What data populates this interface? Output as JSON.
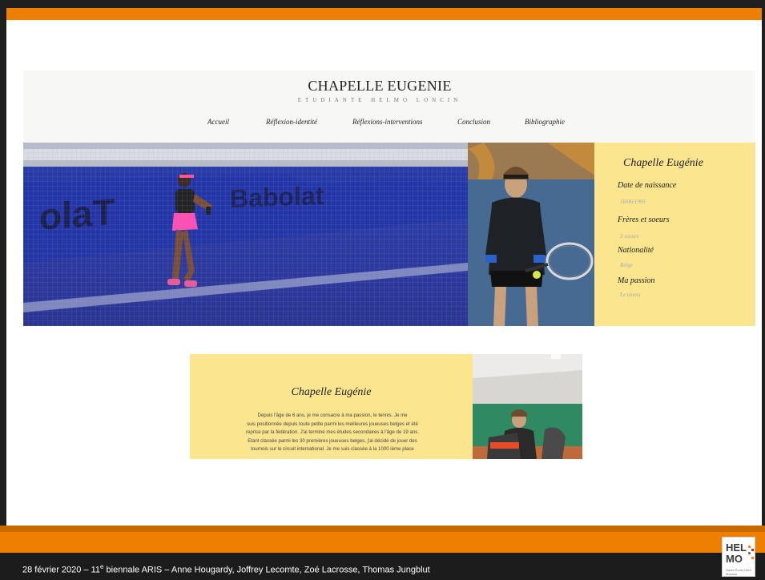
{
  "footer": {
    "text_before": "28 février 2020 – 11",
    "superscript": "e",
    "text_after": " biennale  ARIS – Anne Hougardy, Joffrey Lecomte, Zoé Lacrosse, Thomas Jungblut"
  },
  "logo": {
    "line1": "HEL",
    "line2": "MO",
    "subtitle": "Haute École Libre Mosane"
  },
  "site": {
    "title": "CHAPELLE EUGENIE",
    "subtitle": "ETUDIANTE HELMO LONCIN",
    "nav": [
      "Accueil",
      "Réflexion-identité",
      "Réflexions-interventions",
      "Conclusion",
      "Bibliographie"
    ],
    "hero_banner_text": "Babolat",
    "info": {
      "name": "Chapelle Eugénie",
      "birth_label": "Date de naissance",
      "birth_value": "16/06/1995",
      "siblings_label": "Frères et soeurs",
      "siblings_value": "3 soeurs",
      "nationality_label": "Nationalité",
      "nationality_value": "Belge",
      "passion_label": "Ma passion",
      "passion_value": "Le tennis"
    },
    "bio": {
      "name": "Chapelle Eugénie",
      "lines": [
        "Depuis l'âge de 6 ans, je me consacre à ma passion, le tennis. Je me",
        "suis positionnée depuis toute petite parmi les meilleures joueuses belges et été",
        "reprise par la fédération. J'ai terminé mes études secondaires à l'âge de 19 ans.",
        "Etant classée parmi les 30 premières joueuses belges, j'ai décidé de jouer des",
        "tournois sur le circuit international. Je me suis classée à la 1000 ième place"
      ]
    }
  },
  "colors": {
    "accent_orange": "#ee7f00",
    "info_yellow": "#fbe58f",
    "footer_dark": "#1c1c1c",
    "court_blue": "#2a3fb8"
  }
}
